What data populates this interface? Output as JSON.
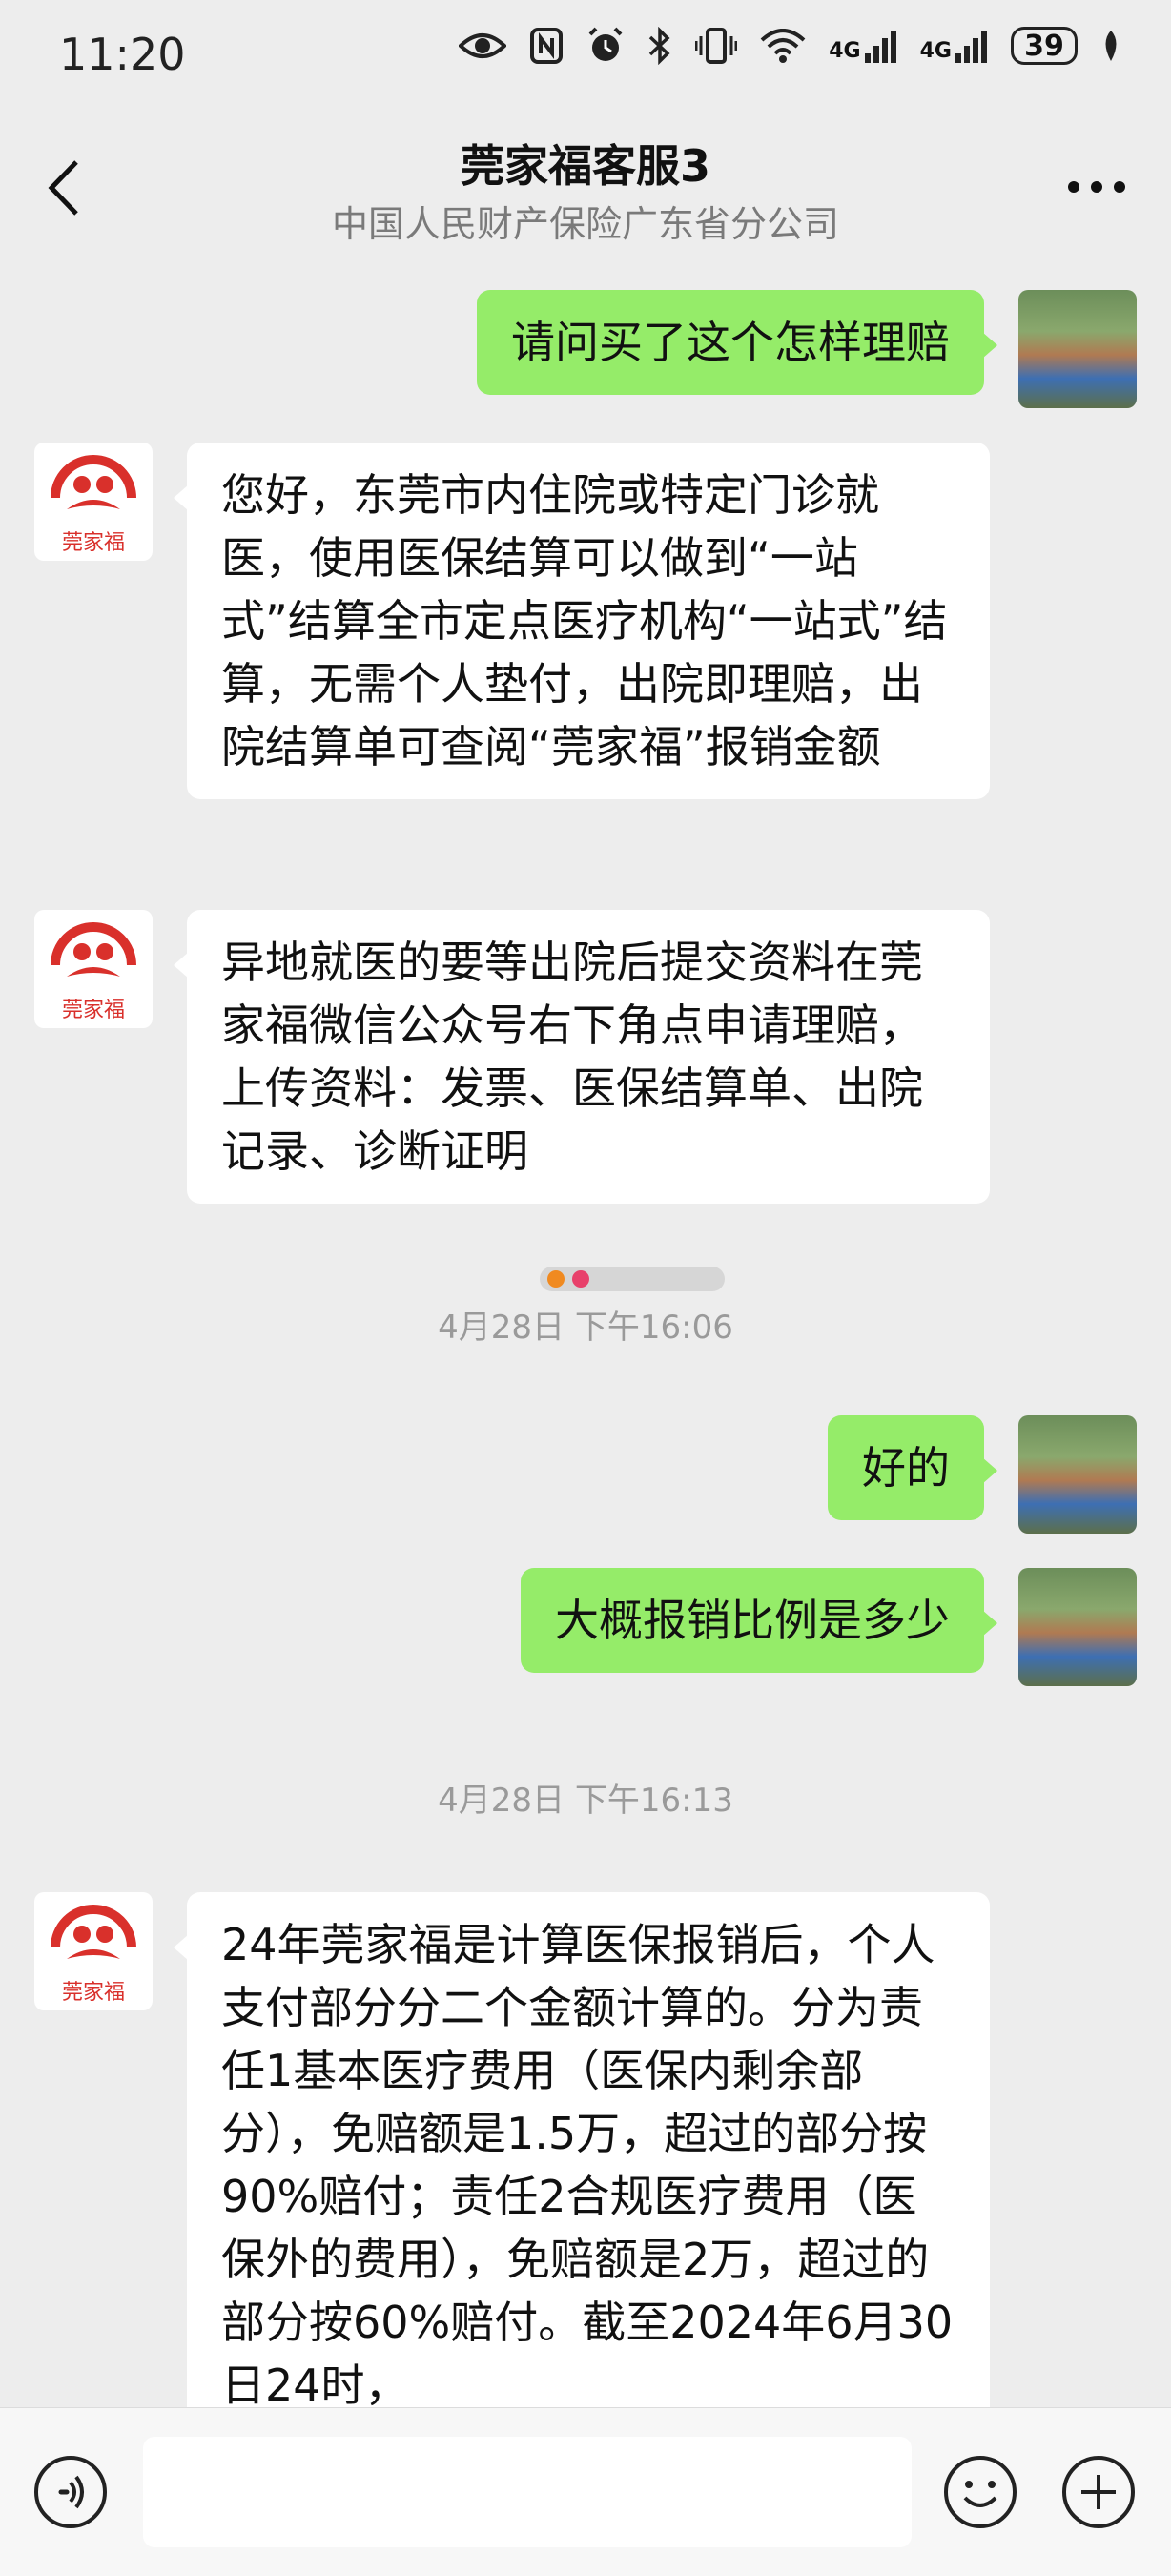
{
  "status_bar": {
    "time": "11:20",
    "network_label_1": "4G",
    "network_label_2": "4G",
    "battery": "39",
    "icons": [
      "eye-icon",
      "nfc-icon",
      "alarm-icon",
      "bluetooth-icon",
      "vibrate-icon",
      "wifi-icon",
      "signal-icon",
      "battery-icon",
      "leaf-icon"
    ]
  },
  "header": {
    "title": "莞家福客服3",
    "subtitle": "中国人民财产保险广东省分公司"
  },
  "messages": [
    {
      "side": "sent",
      "text": "请问买了这个怎样理赔"
    },
    {
      "side": "recv",
      "text": "您好，东莞市内住院或特定门诊就医，使用医保结算可以做到“一站式”结算全市定点医疗机构“一站式”结算，无需个人垫付，出院即理赔，出院结算单可查阅“莞家福”报销金额"
    },
    {
      "side": "recv",
      "text": "异地就医的要等出院后提交资料在莞家福微信公众号右下角点申请理赔，上传资料：发票、医保结算单、出院记录、诊断证明"
    },
    {
      "side": "sent",
      "text": "好的"
    },
    {
      "side": "sent",
      "text": "大概报销比例是多少"
    },
    {
      "side": "recv",
      "text": "24年莞家福是计算医保报销后，个人支付部分分二个金额计算的。分为责任1基本医疗费用（医保内剩余部分），免赔额是1.5万，超过的部分按90%赔付；责任2合规医疗费用（医保外的费用），免赔额是2万，超过的部分按60%赔付。截至2024年6月30日24时，"
    }
  ],
  "timestamps": [
    "4月28日 下午16:06",
    "4月28日 下午16:13"
  ],
  "brand_avatar_text": "莞家福",
  "input": {
    "placeholder": ""
  },
  "colors": {
    "sent_bubble": "#95ec69",
    "recv_bubble": "#ffffff",
    "background": "#ededed",
    "brand_red": "#d9302b"
  }
}
